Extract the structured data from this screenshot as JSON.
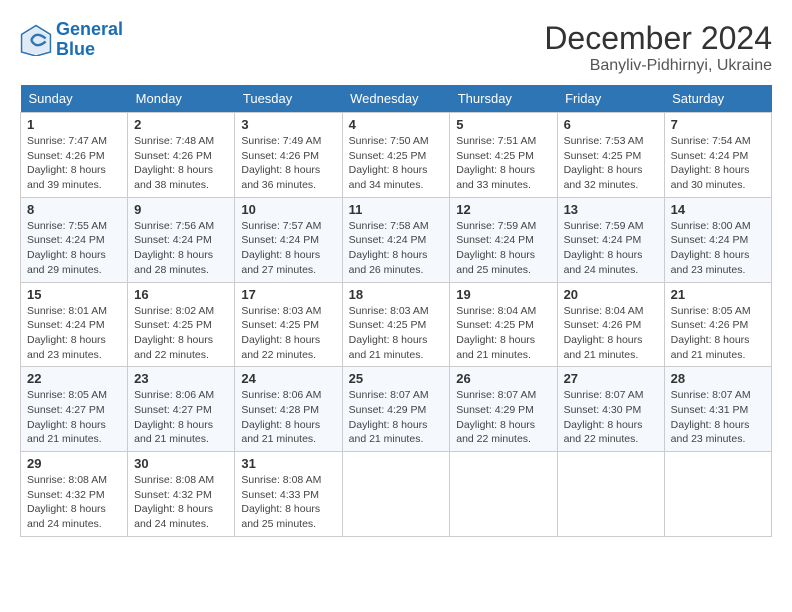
{
  "header": {
    "logo_line1": "General",
    "logo_line2": "Blue",
    "month_year": "December 2024",
    "location": "Banyliv-Pidhirnyi, Ukraine"
  },
  "weekdays": [
    "Sunday",
    "Monday",
    "Tuesday",
    "Wednesday",
    "Thursday",
    "Friday",
    "Saturday"
  ],
  "weeks": [
    [
      {
        "day": "1",
        "sunrise": "7:47 AM",
        "sunset": "4:26 PM",
        "daylight": "8 hours and 39 minutes."
      },
      {
        "day": "2",
        "sunrise": "7:48 AM",
        "sunset": "4:26 PM",
        "daylight": "8 hours and 38 minutes."
      },
      {
        "day": "3",
        "sunrise": "7:49 AM",
        "sunset": "4:26 PM",
        "daylight": "8 hours and 36 minutes."
      },
      {
        "day": "4",
        "sunrise": "7:50 AM",
        "sunset": "4:25 PM",
        "daylight": "8 hours and 34 minutes."
      },
      {
        "day": "5",
        "sunrise": "7:51 AM",
        "sunset": "4:25 PM",
        "daylight": "8 hours and 33 minutes."
      },
      {
        "day": "6",
        "sunrise": "7:53 AM",
        "sunset": "4:25 PM",
        "daylight": "8 hours and 32 minutes."
      },
      {
        "day": "7",
        "sunrise": "7:54 AM",
        "sunset": "4:24 PM",
        "daylight": "8 hours and 30 minutes."
      }
    ],
    [
      {
        "day": "8",
        "sunrise": "7:55 AM",
        "sunset": "4:24 PM",
        "daylight": "8 hours and 29 minutes."
      },
      {
        "day": "9",
        "sunrise": "7:56 AM",
        "sunset": "4:24 PM",
        "daylight": "8 hours and 28 minutes."
      },
      {
        "day": "10",
        "sunrise": "7:57 AM",
        "sunset": "4:24 PM",
        "daylight": "8 hours and 27 minutes."
      },
      {
        "day": "11",
        "sunrise": "7:58 AM",
        "sunset": "4:24 PM",
        "daylight": "8 hours and 26 minutes."
      },
      {
        "day": "12",
        "sunrise": "7:59 AM",
        "sunset": "4:24 PM",
        "daylight": "8 hours and 25 minutes."
      },
      {
        "day": "13",
        "sunrise": "7:59 AM",
        "sunset": "4:24 PM",
        "daylight": "8 hours and 24 minutes."
      },
      {
        "day": "14",
        "sunrise": "8:00 AM",
        "sunset": "4:24 PM",
        "daylight": "8 hours and 23 minutes."
      }
    ],
    [
      {
        "day": "15",
        "sunrise": "8:01 AM",
        "sunset": "4:24 PM",
        "daylight": "8 hours and 23 minutes."
      },
      {
        "day": "16",
        "sunrise": "8:02 AM",
        "sunset": "4:25 PM",
        "daylight": "8 hours and 22 minutes."
      },
      {
        "day": "17",
        "sunrise": "8:03 AM",
        "sunset": "4:25 PM",
        "daylight": "8 hours and 22 minutes."
      },
      {
        "day": "18",
        "sunrise": "8:03 AM",
        "sunset": "4:25 PM",
        "daylight": "8 hours and 21 minutes."
      },
      {
        "day": "19",
        "sunrise": "8:04 AM",
        "sunset": "4:25 PM",
        "daylight": "8 hours and 21 minutes."
      },
      {
        "day": "20",
        "sunrise": "8:04 AM",
        "sunset": "4:26 PM",
        "daylight": "8 hours and 21 minutes."
      },
      {
        "day": "21",
        "sunrise": "8:05 AM",
        "sunset": "4:26 PM",
        "daylight": "8 hours and 21 minutes."
      }
    ],
    [
      {
        "day": "22",
        "sunrise": "8:05 AM",
        "sunset": "4:27 PM",
        "daylight": "8 hours and 21 minutes."
      },
      {
        "day": "23",
        "sunrise": "8:06 AM",
        "sunset": "4:27 PM",
        "daylight": "8 hours and 21 minutes."
      },
      {
        "day": "24",
        "sunrise": "8:06 AM",
        "sunset": "4:28 PM",
        "daylight": "8 hours and 21 minutes."
      },
      {
        "day": "25",
        "sunrise": "8:07 AM",
        "sunset": "4:29 PM",
        "daylight": "8 hours and 21 minutes."
      },
      {
        "day": "26",
        "sunrise": "8:07 AM",
        "sunset": "4:29 PM",
        "daylight": "8 hours and 22 minutes."
      },
      {
        "day": "27",
        "sunrise": "8:07 AM",
        "sunset": "4:30 PM",
        "daylight": "8 hours and 22 minutes."
      },
      {
        "day": "28",
        "sunrise": "8:07 AM",
        "sunset": "4:31 PM",
        "daylight": "8 hours and 23 minutes."
      }
    ],
    [
      {
        "day": "29",
        "sunrise": "8:08 AM",
        "sunset": "4:32 PM",
        "daylight": "8 hours and 24 minutes."
      },
      {
        "day": "30",
        "sunrise": "8:08 AM",
        "sunset": "4:32 PM",
        "daylight": "8 hours and 24 minutes."
      },
      {
        "day": "31",
        "sunrise": "8:08 AM",
        "sunset": "4:33 PM",
        "daylight": "8 hours and 25 minutes."
      },
      null,
      null,
      null,
      null
    ]
  ]
}
